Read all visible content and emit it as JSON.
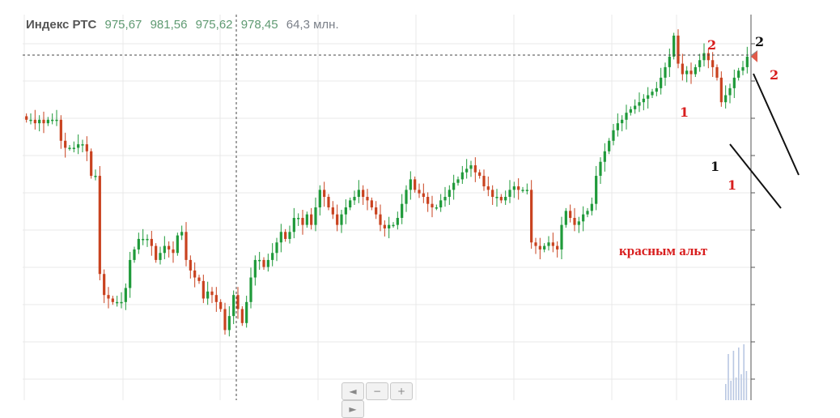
{
  "header": {
    "title": "Индекс РТС",
    "open": "975,67",
    "high": "981,56",
    "low": "975,62",
    "close": "978,45",
    "volume": "64,3 млн."
  },
  "annotations": {
    "black_1": "1",
    "black_2": "2",
    "red_1_top": "1",
    "red_2_top": "2",
    "red_2_right": "2",
    "red_1_bottom": "1",
    "note": "красным альт"
  },
  "nav": {
    "back_icon": "◄",
    "zoom_out_icon": "−",
    "zoom_in_icon": "+",
    "forward_icon": "►"
  },
  "colors": {
    "up": "#1f9a3a",
    "down": "#c9421f",
    "grid": "#e9e9e9",
    "axis": "#555555",
    "label_red": "#d81e1e"
  },
  "chart_data": {
    "type": "candlestick",
    "title": "Индекс РТС",
    "ohlc_last": [
      975.67,
      981.56,
      975.62,
      978.45
    ],
    "volume_last": "64,3 млн.",
    "y_reference": [
      978.45,
      981.56
    ],
    "close_series": [
      960,
      960,
      959,
      960,
      959,
      960,
      960,
      960,
      954,
      952,
      952,
      952,
      953,
      953,
      951,
      944,
      944,
      916,
      910,
      909,
      908,
      908,
      908,
      912,
      920,
      923,
      926,
      926,
      926,
      924,
      920,
      922,
      924,
      923,
      922,
      927,
      928,
      920,
      917,
      915,
      914,
      909,
      911,
      910,
      908,
      906,
      900,
      904,
      910,
      906,
      902,
      908,
      915,
      920,
      920,
      918,
      920,
      922,
      925,
      928,
      926,
      928,
      932,
      932,
      930,
      933,
      930,
      935,
      940,
      938,
      935,
      933,
      930,
      933,
      935,
      937,
      938,
      940,
      938,
      937,
      935,
      933,
      930,
      929,
      930,
      930,
      932,
      936,
      940,
      943,
      940,
      939,
      938,
      936,
      935,
      935,
      937,
      938,
      940,
      942,
      943,
      945,
      946,
      947,
      945,
      944,
      941,
      940,
      938,
      938,
      937,
      938,
      940,
      941,
      940,
      940,
      940,
      925,
      924,
      923,
      924,
      925,
      924,
      923,
      930,
      934,
      932,
      930,
      931,
      933,
      934,
      936,
      944,
      948,
      951,
      954,
      957,
      959,
      960,
      962,
      963,
      964,
      965,
      966,
      967,
      968,
      969,
      972,
      975,
      978,
      984,
      976,
      973,
      974,
      973,
      975,
      977,
      979,
      977,
      975,
      972,
      965,
      967,
      969,
      972,
      974,
      975,
      978
    ],
    "grid": true,
    "crosshair": "on",
    "legend": "none"
  }
}
